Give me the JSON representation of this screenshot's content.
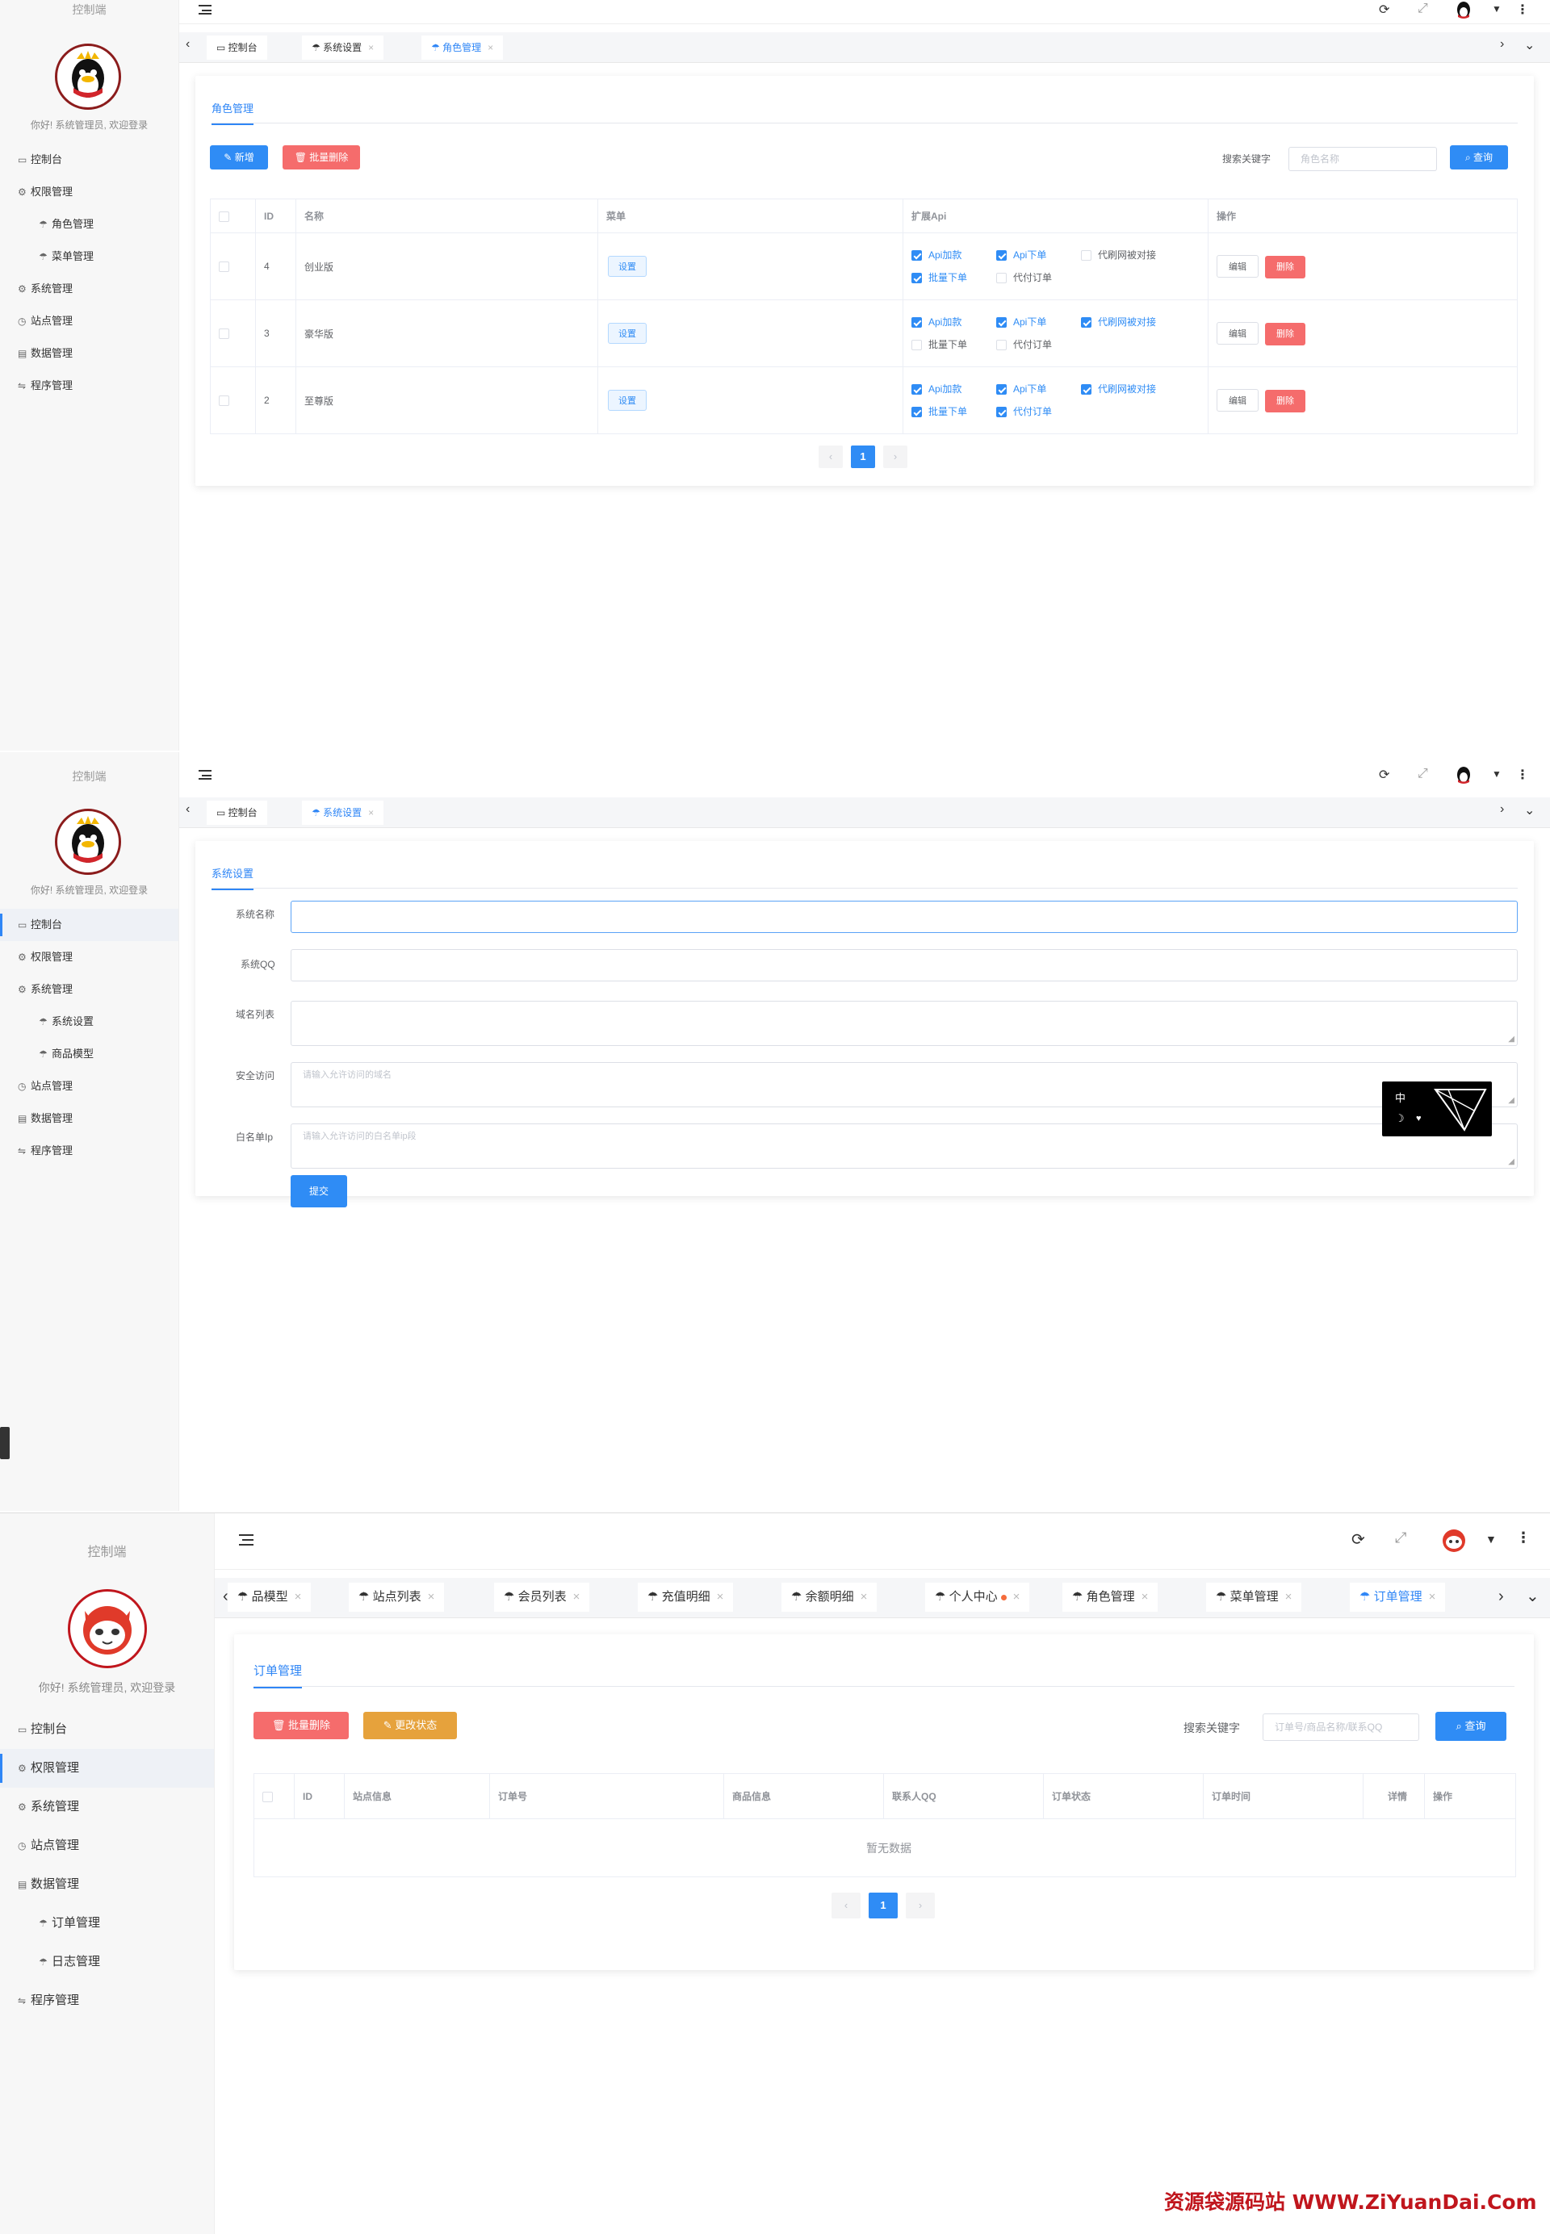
{
  "app": {
    "brand": "控制端",
    "greeting": "你好! 系统管理员, 欢迎登录"
  },
  "panel1": {
    "menu": [
      {
        "icon": "monitor-icon",
        "label": "控制台"
      },
      {
        "icon": "gear-icon",
        "label": "权限管理"
      },
      {
        "icon": "umbrella-icon",
        "label": "角色管理",
        "sub": true
      },
      {
        "icon": "umbrella-icon",
        "label": "菜单管理",
        "sub": true
      },
      {
        "icon": "gear-icon",
        "label": "系统管理"
      },
      {
        "icon": "clock-icon",
        "label": "站点管理"
      },
      {
        "icon": "grid-icon",
        "label": "数据管理"
      },
      {
        "icon": "code-icon",
        "label": "程序管理"
      }
    ],
    "tabs": [
      {
        "label": "控制台"
      },
      {
        "label": "系统设置"
      },
      {
        "label": "角色管理"
      }
    ],
    "title": "角色管理",
    "add_btn": "新增",
    "batch_delete_btn": "批量删除",
    "search_label": "搜索关键字",
    "search_placeholder": "角色名称",
    "query_btn": "查询",
    "columns": [
      "ID",
      "名称",
      "菜单",
      "扩展Api",
      "操作"
    ],
    "rows": [
      {
        "id": "4",
        "name": "创业版",
        "menu_btn": "设置",
        "apis": [
          {
            "label": "Api加款",
            "checked": true
          },
          {
            "label": "Api下单",
            "checked": true
          },
          {
            "label": "代刷网被对接",
            "checked": false
          },
          {
            "label": "批量下单",
            "checked": true
          },
          {
            "label": "代付订单",
            "checked": false
          }
        ],
        "edit": "编辑",
        "del": "删除"
      },
      {
        "id": "3",
        "name": "豪华版",
        "menu_btn": "设置",
        "apis": [
          {
            "label": "Api加款",
            "checked": true
          },
          {
            "label": "Api下单",
            "checked": true
          },
          {
            "label": "代刷网被对接",
            "checked": true
          },
          {
            "label": "批量下单",
            "checked": false
          },
          {
            "label": "代付订单",
            "checked": false
          }
        ],
        "edit": "编辑",
        "del": "删除"
      },
      {
        "id": "2",
        "name": "至尊版",
        "menu_btn": "设置",
        "apis": [
          {
            "label": "Api加款",
            "checked": true
          },
          {
            "label": "Api下单",
            "checked": true
          },
          {
            "label": "代刷网被对接",
            "checked": true
          },
          {
            "label": "批量下单",
            "checked": true
          },
          {
            "label": "代付订单",
            "checked": true
          }
        ],
        "edit": "编辑",
        "del": "删除"
      }
    ],
    "page": "1"
  },
  "panel2": {
    "menu": [
      {
        "icon": "monitor-icon",
        "label": "控制台",
        "active": true
      },
      {
        "icon": "gear-icon",
        "label": "权限管理"
      },
      {
        "icon": "gear-icon",
        "label": "系统管理"
      },
      {
        "icon": "umbrella-icon",
        "label": "系统设置",
        "sub": true
      },
      {
        "icon": "umbrella-icon",
        "label": "商品模型",
        "sub": true
      },
      {
        "icon": "clock-icon",
        "label": "站点管理"
      },
      {
        "icon": "grid-icon",
        "label": "数据管理"
      },
      {
        "icon": "code-icon",
        "label": "程序管理"
      }
    ],
    "tabs": [
      {
        "label": "控制台"
      },
      {
        "label": "系统设置"
      }
    ],
    "title": "系统设置",
    "fields": {
      "name_label": "系统名称",
      "qq_label": "系统QQ",
      "domains_label": "域名列表",
      "secure_label": "安全访问",
      "secure_placeholder": "请输入允许访问的域名",
      "whitelist_label": "白名单Ip",
      "whitelist_placeholder": "请输入允许访问的白名单ip段"
    },
    "submit_btn": "提交",
    "ime_char": "中"
  },
  "panel3": {
    "menu": [
      {
        "icon": "monitor-icon",
        "label": "控制台"
      },
      {
        "icon": "gear-icon",
        "label": "权限管理",
        "active": true
      },
      {
        "icon": "gear-icon",
        "label": "系统管理"
      },
      {
        "icon": "clock-icon",
        "label": "站点管理"
      },
      {
        "icon": "grid-icon",
        "label": "数据管理"
      },
      {
        "icon": "umbrella-icon",
        "label": "订单管理",
        "sub": true
      },
      {
        "icon": "umbrella-icon",
        "label": "日志管理",
        "sub": true
      },
      {
        "icon": "code-icon",
        "label": "程序管理"
      }
    ],
    "tabs": [
      {
        "label": "品模型"
      },
      {
        "label": "站点列表"
      },
      {
        "label": "会员列表"
      },
      {
        "label": "充值明细"
      },
      {
        "label": "余额明细"
      },
      {
        "label": "个人中心"
      },
      {
        "label": "角色管理"
      },
      {
        "label": "菜单管理"
      },
      {
        "label": "订单管理"
      }
    ],
    "title": "订单管理",
    "batch_delete_btn": "批量删除",
    "change_status_btn": "更改状态",
    "search_label": "搜索关键字",
    "search_placeholder": "订单号/商品名称/联系QQ",
    "query_btn": "查询",
    "columns": [
      "ID",
      "站点信息",
      "订单号",
      "商品信息",
      "联系人QQ",
      "订单状态",
      "订单时间",
      "详情",
      "操作"
    ],
    "empty": "暂无数据",
    "page": "1"
  },
  "watermark": "资源袋源码站 WWW.ZiYuanDai.Com",
  "colors": {
    "primary": "#2f8cf5",
    "danger": "#f56c6c",
    "warning": "#e6a23c"
  }
}
